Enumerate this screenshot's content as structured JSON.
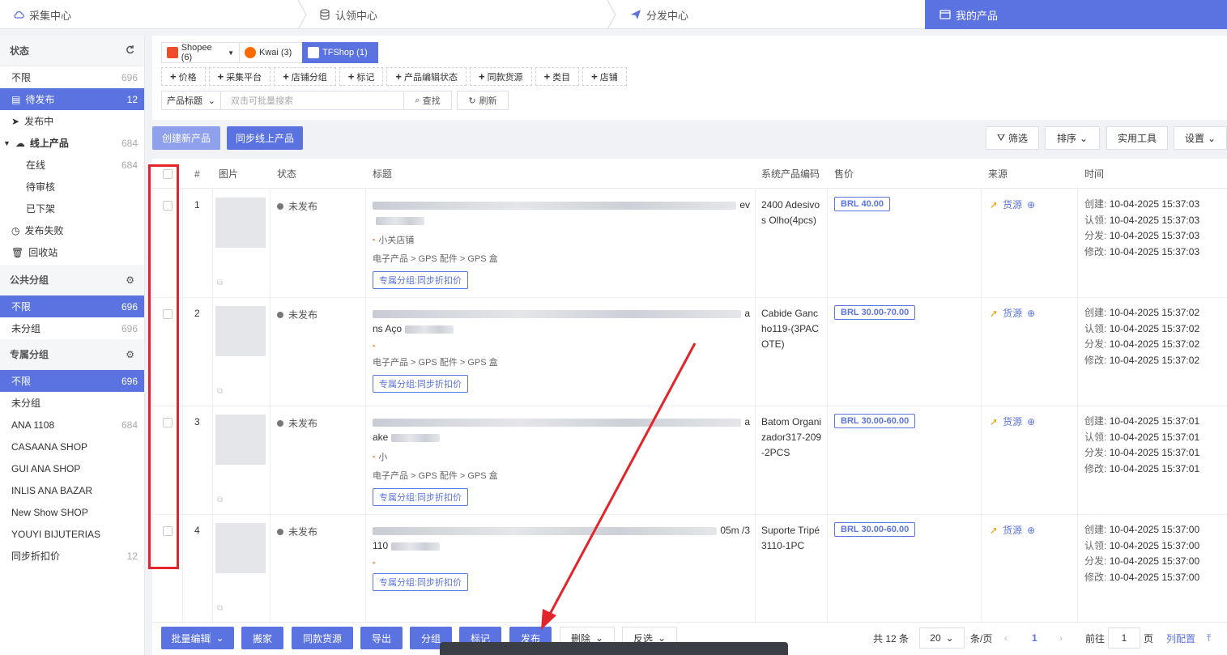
{
  "topnav": {
    "steps": [
      {
        "label": "采集中心",
        "icon": "cloud-icon"
      },
      {
        "label": "认领中心",
        "icon": "database-icon"
      },
      {
        "label": "分发中心",
        "icon": "send-icon"
      },
      {
        "label": "我的产品",
        "icon": "products-icon"
      }
    ],
    "active_index": 3
  },
  "sidebar": {
    "status_section": "状态",
    "status_items": [
      {
        "label": "不限",
        "count": "696"
      },
      {
        "label": "待发布",
        "count": "12",
        "active": true
      },
      {
        "label": "发布中",
        "count": ""
      },
      {
        "label": "线上产品",
        "count": "684"
      },
      {
        "label": "在线",
        "count": "684"
      },
      {
        "label": "待审核",
        "count": ""
      },
      {
        "label": "已下架",
        "count": ""
      },
      {
        "label": "发布失败",
        "count": ""
      },
      {
        "label": "回收站",
        "count": ""
      }
    ],
    "public_section": "公共分组",
    "public_items": [
      {
        "label": "不限",
        "count": "696",
        "active": true
      },
      {
        "label": "未分组",
        "count": "696"
      }
    ],
    "private_section": "专属分组",
    "private_items": [
      {
        "label": "不限",
        "count": "696",
        "active": true
      },
      {
        "label": "未分组",
        "count": ""
      },
      {
        "label": "ANA 1108",
        "count": "684"
      },
      {
        "label": "CASAANA SHOP",
        "count": ""
      },
      {
        "label": "GUI ANA SHOP",
        "count": ""
      },
      {
        "label": "INLIS ANA BAZAR",
        "count": ""
      },
      {
        "label": "New Show SHOP",
        "count": ""
      },
      {
        "label": "YOUYI BIJUTERIAS",
        "count": ""
      },
      {
        "label": "同步折扣价",
        "count": "12"
      }
    ]
  },
  "platform_tabs": [
    {
      "label": "Shopee (6)",
      "color": "#ee4d2d"
    },
    {
      "label": "Kwai (3)",
      "color": "#ff6a00"
    },
    {
      "label": "TFShop (1)",
      "color": "#ff8a3d"
    }
  ],
  "filters": [
    "价格",
    "采集平台",
    "店铺分组",
    "标记",
    "产品编辑状态",
    "同款货源",
    "类目",
    "店铺"
  ],
  "search": {
    "field_select": "产品标题",
    "placeholder": "双击可批量搜索",
    "search_button": "查找",
    "refresh_button": "刷新"
  },
  "toolbar": {
    "create": "创建新产品",
    "sync": "同步线上产品",
    "filter": "筛选",
    "sort": "排序",
    "tools": "实用工具",
    "settings": "设置"
  },
  "table": {
    "headers": {
      "num": "#",
      "image": "图片",
      "status": "状态",
      "title": "标题",
      "code": "系统产品编码",
      "price": "售价",
      "source": "来源",
      "time": "时间"
    },
    "rows": [
      {
        "num": "1",
        "status": "未发布",
        "title_tail": "ev",
        "title_line2": "",
        "shop": "小关店铺",
        "category": "电子产品 > GPS 配件 > GPS 盒",
        "tag": "专属分组:同步折扣价",
        "code": "2400 Adesivos Olho(4pcs)",
        "price": "BRL  40.00",
        "source": "货源",
        "created": "10-04-2025 15:37:03",
        "claimed": "10-04-2025 15:37:03",
        "distributed": "10-04-2025 15:37:03",
        "modified": "10-04-2025 15:37:03"
      },
      {
        "num": "2",
        "status": "未发布",
        "title_tail": "a",
        "title_line2": "ns Aço",
        "shop": "",
        "category": "电子产品 > GPS 配件 > GPS 盒",
        "tag": "专属分组:同步折扣价",
        "code": "Cabide Gancho119-(3PACOTE)",
        "price": "BRL  30.00-70.00",
        "source": "货源",
        "created": "10-04-2025 15:37:02",
        "claimed": "10-04-2025 15:37:02",
        "distributed": "10-04-2025 15:37:02",
        "modified": "10-04-2025 15:37:02"
      },
      {
        "num": "3",
        "status": "未发布",
        "title_tail": "a",
        "title_line2": "ake",
        "shop": "小",
        "category": "电子产品 > GPS 配件 > GPS 盒",
        "tag": "专属分组:同步折扣价",
        "code": "Batom Organizador317-209-2PCS",
        "price": "BRL  30.00-60.00",
        "source": "货源",
        "created": "10-04-2025 15:37:01",
        "claimed": "10-04-2025 15:37:01",
        "distributed": "10-04-2025 15:37:01",
        "modified": "10-04-2025 15:37:01"
      },
      {
        "num": "4",
        "status": "未发布",
        "title_tail": "05m /3",
        "title_line2": "110",
        "shop": "",
        "category": "",
        "tag": "专属分组:同步折扣价",
        "code": "Suporte Tripé3110-1PC",
        "price": "BRL  30.00-60.00",
        "source": "货源",
        "created": "10-04-2025 15:37:00",
        "claimed": "10-04-2025 15:37:00",
        "distributed": "10-04-2025 15:37:00",
        "modified": "10-04-2025 15:37:00"
      }
    ],
    "time_labels": {
      "created": "创建:",
      "claimed": "认领:",
      "distributed": "分发:",
      "modified": "修改:"
    }
  },
  "bottom": {
    "batch_edit": "批量编辑",
    "move": "搬家",
    "same_source": "同款货源",
    "export": "导出",
    "group": "分组",
    "mark": "标记",
    "publish": "发布",
    "delete": "删除",
    "invert": "反选",
    "total": "共 12 条",
    "page_size": "20",
    "per_page": "条/页",
    "current_page": "1",
    "goto": "前往",
    "goto_page": "1",
    "page_unit": "页",
    "columns": "列配置"
  },
  "colors": {
    "accent": "#5b73e0",
    "annotation": "#e3242b"
  }
}
